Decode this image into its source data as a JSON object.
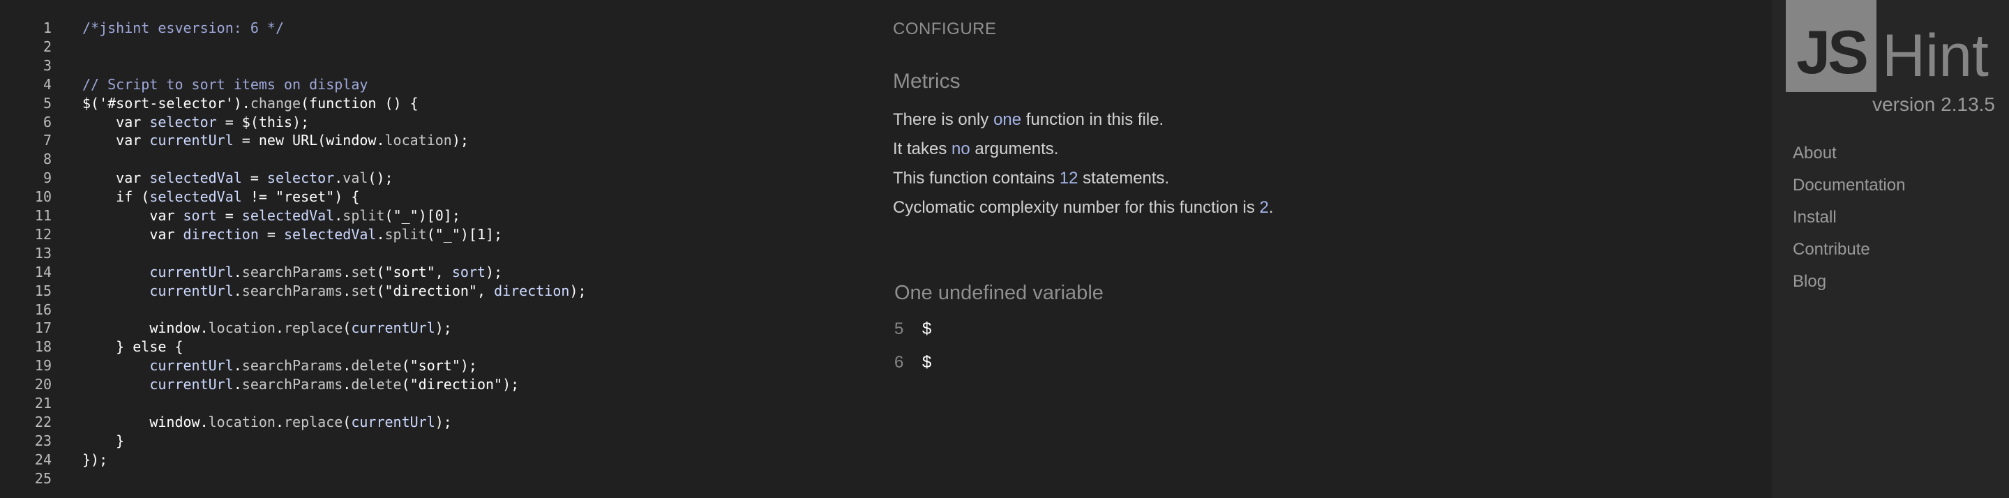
{
  "editor": {
    "lines": [
      {
        "n": "1",
        "tokens": [
          {
            "t": "/*jshint esversion: 6 */",
            "c": "t-com"
          }
        ]
      },
      {
        "n": "2",
        "tokens": []
      },
      {
        "n": "3",
        "tokens": []
      },
      {
        "n": "4",
        "tokens": [
          {
            "t": "// Script to sort items on display",
            "c": "t-com"
          }
        ]
      },
      {
        "n": "5",
        "tokens": [
          {
            "t": "$(",
            "c": ""
          },
          {
            "t": "'#sort-selector'",
            "c": "t-str"
          },
          {
            "t": ").",
            "c": ""
          },
          {
            "t": "change",
            "c": "t-dim"
          },
          {
            "t": "(",
            "c": ""
          },
          {
            "t": "function",
            "c": "t-kw"
          },
          {
            "t": " () {",
            "c": ""
          }
        ]
      },
      {
        "n": "6",
        "tokens": [
          {
            "t": "    var ",
            "c": "t-kw"
          },
          {
            "t": "selector",
            "c": "t-var"
          },
          {
            "t": " = $(",
            "c": ""
          },
          {
            "t": "this",
            "c": "t-kw"
          },
          {
            "t": ");",
            "c": ""
          }
        ]
      },
      {
        "n": "7",
        "tokens": [
          {
            "t": "    var ",
            "c": "t-kw"
          },
          {
            "t": "currentUrl",
            "c": "t-var"
          },
          {
            "t": " = ",
            "c": ""
          },
          {
            "t": "new",
            "c": "t-kw"
          },
          {
            "t": " URL(window.",
            "c": ""
          },
          {
            "t": "location",
            "c": "t-dim"
          },
          {
            "t": ");",
            "c": ""
          }
        ]
      },
      {
        "n": "8",
        "tokens": []
      },
      {
        "n": "9",
        "tokens": [
          {
            "t": "    var ",
            "c": "t-kw"
          },
          {
            "t": "selectedVal",
            "c": "t-var"
          },
          {
            "t": " = ",
            "c": ""
          },
          {
            "t": "selector",
            "c": "t-var"
          },
          {
            "t": ".",
            "c": ""
          },
          {
            "t": "val",
            "c": "t-dim"
          },
          {
            "t": "();",
            "c": ""
          }
        ]
      },
      {
        "n": "10",
        "tokens": [
          {
            "t": "    if",
            "c": "t-kw"
          },
          {
            "t": " (",
            "c": ""
          },
          {
            "t": "selectedVal",
            "c": "t-var"
          },
          {
            "t": " != ",
            "c": ""
          },
          {
            "t": "\"reset\"",
            "c": "t-str"
          },
          {
            "t": ") {",
            "c": ""
          }
        ]
      },
      {
        "n": "11",
        "tokens": [
          {
            "t": "        var ",
            "c": "t-kw"
          },
          {
            "t": "sort",
            "c": "t-var"
          },
          {
            "t": " = ",
            "c": ""
          },
          {
            "t": "selectedVal",
            "c": "t-var"
          },
          {
            "t": ".",
            "c": ""
          },
          {
            "t": "split",
            "c": "t-dim"
          },
          {
            "t": "(",
            "c": ""
          },
          {
            "t": "\"_\"",
            "c": "t-str"
          },
          {
            "t": ")[0];",
            "c": ""
          }
        ]
      },
      {
        "n": "12",
        "tokens": [
          {
            "t": "        var ",
            "c": "t-kw"
          },
          {
            "t": "direction",
            "c": "t-var"
          },
          {
            "t": " = ",
            "c": ""
          },
          {
            "t": "selectedVal",
            "c": "t-var"
          },
          {
            "t": ".",
            "c": ""
          },
          {
            "t": "split",
            "c": "t-dim"
          },
          {
            "t": "(",
            "c": ""
          },
          {
            "t": "\"_\"",
            "c": "t-str"
          },
          {
            "t": ")[1];",
            "c": ""
          }
        ]
      },
      {
        "n": "13",
        "tokens": []
      },
      {
        "n": "14",
        "tokens": [
          {
            "t": "        currentUrl",
            "c": "t-var"
          },
          {
            "t": ".",
            "c": ""
          },
          {
            "t": "searchParams",
            "c": "t-dim"
          },
          {
            "t": ".",
            "c": ""
          },
          {
            "t": "set",
            "c": "t-dim"
          },
          {
            "t": "(",
            "c": ""
          },
          {
            "t": "\"sort\"",
            "c": "t-str"
          },
          {
            "t": ", ",
            "c": ""
          },
          {
            "t": "sort",
            "c": "t-var"
          },
          {
            "t": ");",
            "c": ""
          }
        ]
      },
      {
        "n": "15",
        "tokens": [
          {
            "t": "        currentUrl",
            "c": "t-var"
          },
          {
            "t": ".",
            "c": ""
          },
          {
            "t": "searchParams",
            "c": "t-dim"
          },
          {
            "t": ".",
            "c": ""
          },
          {
            "t": "set",
            "c": "t-dim"
          },
          {
            "t": "(",
            "c": ""
          },
          {
            "t": "\"direction\"",
            "c": "t-str"
          },
          {
            "t": ", ",
            "c": ""
          },
          {
            "t": "direction",
            "c": "t-var"
          },
          {
            "t": ");",
            "c": ""
          }
        ]
      },
      {
        "n": "16",
        "tokens": []
      },
      {
        "n": "17",
        "tokens": [
          {
            "t": "        window.",
            "c": ""
          },
          {
            "t": "location",
            "c": "t-dim"
          },
          {
            "t": ".",
            "c": ""
          },
          {
            "t": "replace",
            "c": "t-dim"
          },
          {
            "t": "(",
            "c": ""
          },
          {
            "t": "currentUrl",
            "c": "t-var"
          },
          {
            "t": ");",
            "c": ""
          }
        ]
      },
      {
        "n": "18",
        "tokens": [
          {
            "t": "    } ",
            "c": ""
          },
          {
            "t": "else",
            "c": "t-kw"
          },
          {
            "t": " {",
            "c": ""
          }
        ]
      },
      {
        "n": "19",
        "tokens": [
          {
            "t": "        currentUrl",
            "c": "t-var"
          },
          {
            "t": ".",
            "c": ""
          },
          {
            "t": "searchParams",
            "c": "t-dim"
          },
          {
            "t": ".",
            "c": ""
          },
          {
            "t": "delete",
            "c": "t-dim"
          },
          {
            "t": "(",
            "c": ""
          },
          {
            "t": "\"sort\"",
            "c": "t-str"
          },
          {
            "t": ");",
            "c": ""
          }
        ]
      },
      {
        "n": "20",
        "tokens": [
          {
            "t": "        currentUrl",
            "c": "t-var"
          },
          {
            "t": ".",
            "c": ""
          },
          {
            "t": "searchParams",
            "c": "t-dim"
          },
          {
            "t": ".",
            "c": ""
          },
          {
            "t": "delete",
            "c": "t-dim"
          },
          {
            "t": "(",
            "c": ""
          },
          {
            "t": "\"direction\"",
            "c": "t-str"
          },
          {
            "t": ");",
            "c": ""
          }
        ]
      },
      {
        "n": "21",
        "tokens": []
      },
      {
        "n": "22",
        "tokens": [
          {
            "t": "        window.",
            "c": ""
          },
          {
            "t": "location",
            "c": "t-dim"
          },
          {
            "t": ".",
            "c": ""
          },
          {
            "t": "replace",
            "c": "t-dim"
          },
          {
            "t": "(",
            "c": ""
          },
          {
            "t": "currentUrl",
            "c": "t-var"
          },
          {
            "t": ");",
            "c": ""
          }
        ]
      },
      {
        "n": "23",
        "tokens": [
          {
            "t": "    }",
            "c": ""
          }
        ]
      },
      {
        "n": "24",
        "tokens": [
          {
            "t": "});",
            "c": ""
          }
        ]
      },
      {
        "n": "25",
        "tokens": []
      }
    ]
  },
  "report": {
    "configure_label": "CONFIGURE",
    "metrics_title": "Metrics",
    "metrics": [
      {
        "before": "There is only ",
        "value": "one",
        "after": " function in this file."
      },
      {
        "before": "It takes ",
        "value": "no",
        "after": " arguments."
      },
      {
        "before": "This function contains ",
        "value": "12",
        "after": " statements."
      },
      {
        "before": "Cyclomatic complexity number for this function is ",
        "value": "2",
        "after": "."
      }
    ],
    "undefined_title": "One undefined variable",
    "undefined": [
      {
        "line": "5",
        "name": "$"
      },
      {
        "line": "6",
        "name": "$"
      }
    ]
  },
  "sidebar": {
    "logo_js": "JS",
    "logo_hint": "Hint",
    "version": "version 2.13.5",
    "nav": [
      {
        "label": "About"
      },
      {
        "label": "Documentation"
      },
      {
        "label": "Install"
      },
      {
        "label": "Contribute"
      },
      {
        "label": "Blog"
      }
    ]
  },
  "colors": {
    "background": "#202020",
    "sidebar": "#262626",
    "accent_number": "#a4b4e8",
    "comment": "#9fa8da"
  }
}
